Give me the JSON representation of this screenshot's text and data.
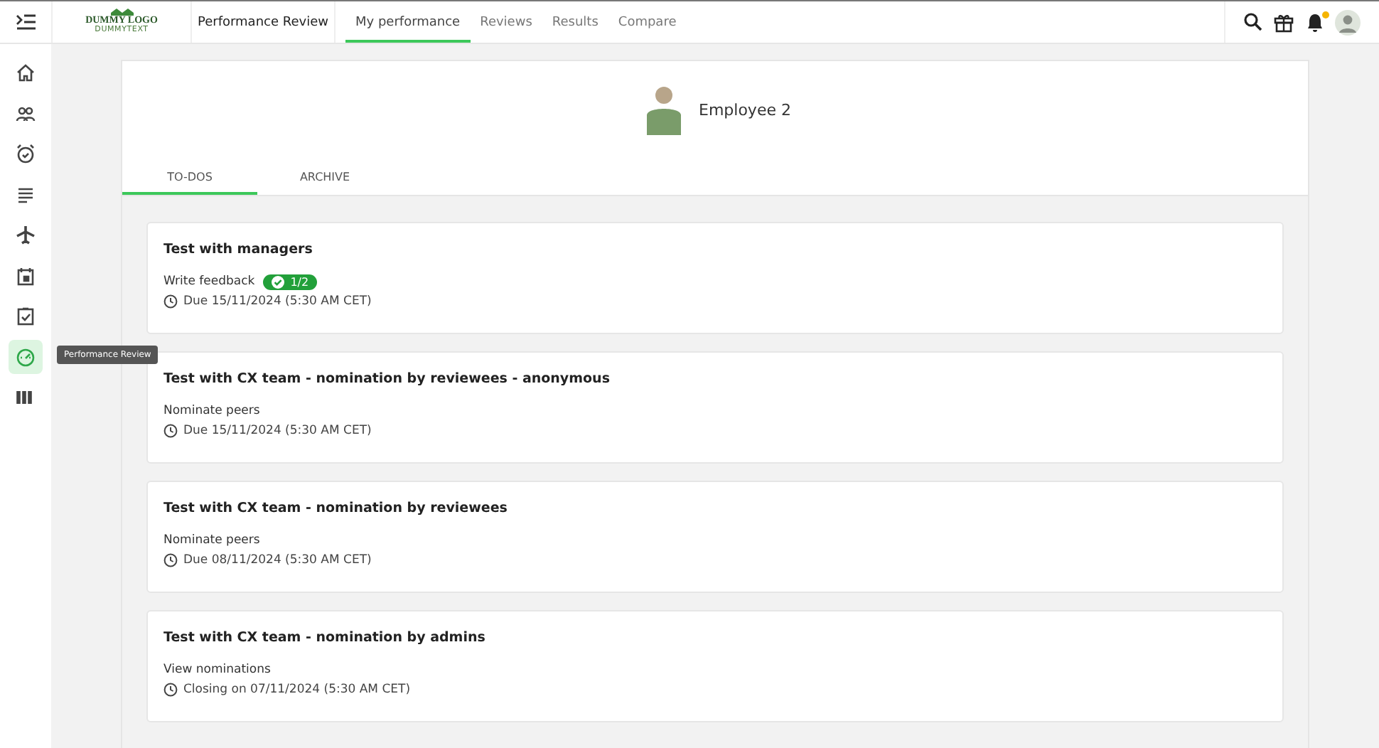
{
  "topbar": {
    "logo": {
      "title": "DUMMY LOGO",
      "subtitle": "DUMMYTEXT"
    },
    "section": "Performance Review",
    "nav": [
      {
        "label": "My performance",
        "selected": true
      },
      {
        "label": "Reviews",
        "selected": false
      },
      {
        "label": "Results",
        "selected": false
      },
      {
        "label": "Compare",
        "selected": false
      }
    ],
    "notification_badge": true
  },
  "sidebar": {
    "items": [
      {
        "kind": "home",
        "selected": false
      },
      {
        "kind": "people",
        "selected": false
      },
      {
        "kind": "alarm",
        "selected": false
      },
      {
        "kind": "list",
        "selected": false
      },
      {
        "kind": "plane",
        "selected": false
      },
      {
        "kind": "calendar",
        "selected": false
      },
      {
        "kind": "clipboard",
        "selected": false
      },
      {
        "kind": "gauge",
        "selected": true
      },
      {
        "kind": "columns",
        "selected": false
      }
    ],
    "tooltip": "Performance Review"
  },
  "profile": {
    "name": "Employee 2"
  },
  "tabs": [
    {
      "label": "TO-DOS",
      "selected": true
    },
    {
      "label": "ARCHIVE",
      "selected": false
    }
  ],
  "tasks": [
    {
      "title": "Test with managers",
      "action": "Write feedback",
      "progress": "1/2",
      "due": "Due 15/11/2024 (5:30 AM CET)"
    },
    {
      "title": "Test with CX team - nomination by reviewees - anonymous",
      "action": "Nominate peers",
      "due": "Due 15/11/2024 (5:30 AM CET)"
    },
    {
      "title": "Test with CX team - nomination by reviewees",
      "action": "Nominate peers",
      "due": "Due 08/11/2024 (5:30 AM CET)"
    },
    {
      "title": "Test with CX team - nomination by admins",
      "action": "View nominations",
      "due": "Closing on 07/11/2024 (5:30 AM CET)"
    }
  ]
}
